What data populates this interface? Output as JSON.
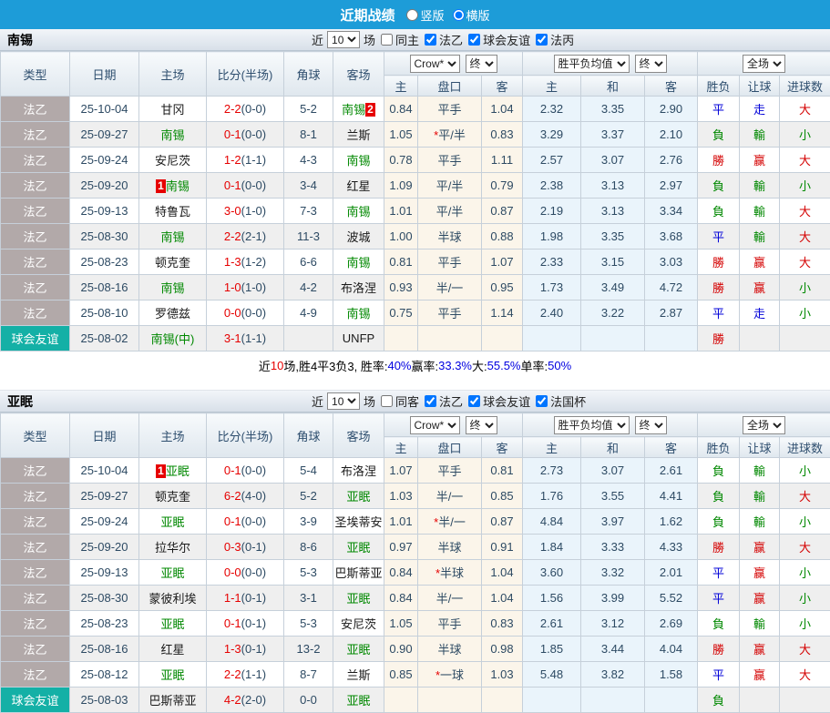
{
  "topbar": {
    "title": "近期战绩",
    "vertical_label": "竖版",
    "horizontal_label": "横版",
    "vertical_checked": false,
    "horizontal_checked": true
  },
  "labels": {
    "near": "近",
    "games": "场"
  },
  "colors": {
    "topbar_blue": "#1d9cd8",
    "league_type_bg": "#b2a9a9",
    "friendly_type_bg": "#14b0a6",
    "win_red": "#d40000",
    "lose_green": "#008800",
    "draw_blue": "#0000d8",
    "odds_col_bg": "#fbf5ea",
    "mean_col_bg": "#eaf4fb",
    "badge_red": "#e60000"
  },
  "table": {
    "main_columns": [
      "类型",
      "日期",
      "主场",
      "比分(半场)",
      "角球",
      "客场"
    ],
    "sub_columns": [
      "主",
      "盘口",
      "客",
      "主",
      "和",
      "客",
      "胜负",
      "让球",
      "进球数"
    ]
  },
  "sections": [
    {
      "team": "南锡",
      "filter": {
        "count": "10",
        "same_label": "同主",
        "same_checked": false,
        "leagues": [
          {
            "label": "法乙",
            "checked": true
          },
          {
            "label": "球会友谊",
            "checked": true
          },
          {
            "label": "法丙",
            "checked": true
          }
        ]
      },
      "dropdowns": {
        "company": "Crow*",
        "time1": "终",
        "mean": "胜平负均值",
        "time2": "终",
        "scope": "全场"
      },
      "rows": [
        {
          "type": "法乙",
          "type_kind": "league",
          "date": "25-10-04",
          "home": {
            "name": "甘冈",
            "green": false
          },
          "score": "2-2",
          "half": "(0-0)",
          "corner": "5-2",
          "away": {
            "name": "南锡",
            "green": true,
            "badge_after": "2"
          },
          "odds": [
            "0.84",
            "平手",
            "1.04"
          ],
          "star": false,
          "mean": [
            "2.32",
            "3.35",
            "2.90"
          ],
          "results": [
            {
              "t": "平",
              "c": "blue"
            },
            {
              "t": "走",
              "c": "blue"
            },
            {
              "t": "大",
              "c": "red"
            }
          ]
        },
        {
          "type": "法乙",
          "type_kind": "league",
          "date": "25-09-27",
          "home": {
            "name": "南锡",
            "green": true
          },
          "score": "0-1",
          "half": "(0-0)",
          "corner": "8-1",
          "away": {
            "name": "兰斯",
            "green": false
          },
          "odds": [
            "1.05",
            "平/半",
            "0.83"
          ],
          "star": true,
          "mean": [
            "3.29",
            "3.37",
            "2.10"
          ],
          "results": [
            {
              "t": "負",
              "c": "green"
            },
            {
              "t": "輸",
              "c": "green"
            },
            {
              "t": "小",
              "c": "green"
            }
          ]
        },
        {
          "type": "法乙",
          "type_kind": "league",
          "date": "25-09-24",
          "home": {
            "name": "安尼茨",
            "green": false
          },
          "score": "1-2",
          "half": "(1-1)",
          "corner": "4-3",
          "away": {
            "name": "南锡",
            "green": true
          },
          "odds": [
            "0.78",
            "平手",
            "1.11"
          ],
          "star": false,
          "mean": [
            "2.57",
            "3.07",
            "2.76"
          ],
          "results": [
            {
              "t": "勝",
              "c": "red"
            },
            {
              "t": "赢",
              "c": "red"
            },
            {
              "t": "大",
              "c": "red"
            }
          ]
        },
        {
          "type": "法乙",
          "type_kind": "league",
          "date": "25-09-20",
          "home": {
            "name": "南锡",
            "green": true,
            "badge_before": "1"
          },
          "score": "0-1",
          "half": "(0-0)",
          "corner": "3-4",
          "away": {
            "name": "红星",
            "green": false
          },
          "odds": [
            "1.09",
            "平/半",
            "0.79"
          ],
          "star": false,
          "mean": [
            "2.38",
            "3.13",
            "2.97"
          ],
          "results": [
            {
              "t": "負",
              "c": "green"
            },
            {
              "t": "輸",
              "c": "green"
            },
            {
              "t": "小",
              "c": "green"
            }
          ]
        },
        {
          "type": "法乙",
          "type_kind": "league",
          "date": "25-09-13",
          "home": {
            "name": "特鲁瓦",
            "green": false
          },
          "score": "3-0",
          "half": "(1-0)",
          "corner": "7-3",
          "away": {
            "name": "南锡",
            "green": true
          },
          "odds": [
            "1.01",
            "平/半",
            "0.87"
          ],
          "star": false,
          "mean": [
            "2.19",
            "3.13",
            "3.34"
          ],
          "results": [
            {
              "t": "負",
              "c": "green"
            },
            {
              "t": "輸",
              "c": "green"
            },
            {
              "t": "大",
              "c": "red"
            }
          ]
        },
        {
          "type": "法乙",
          "type_kind": "league",
          "date": "25-08-30",
          "home": {
            "name": "南锡",
            "green": true
          },
          "score": "2-2",
          "half": "(2-1)",
          "corner": "11-3",
          "away": {
            "name": "波城",
            "green": false
          },
          "odds": [
            "1.00",
            "半球",
            "0.88"
          ],
          "star": false,
          "mean": [
            "1.98",
            "3.35",
            "3.68"
          ],
          "results": [
            {
              "t": "平",
              "c": "blue"
            },
            {
              "t": "輸",
              "c": "green"
            },
            {
              "t": "大",
              "c": "red"
            }
          ]
        },
        {
          "type": "法乙",
          "type_kind": "league",
          "date": "25-08-23",
          "home": {
            "name": "顿克奎",
            "green": false
          },
          "score": "1-3",
          "half": "(1-2)",
          "corner": "6-6",
          "away": {
            "name": "南锡",
            "green": true
          },
          "odds": [
            "0.81",
            "平手",
            "1.07"
          ],
          "star": false,
          "mean": [
            "2.33",
            "3.15",
            "3.03"
          ],
          "results": [
            {
              "t": "勝",
              "c": "red"
            },
            {
              "t": "赢",
              "c": "red"
            },
            {
              "t": "大",
              "c": "red"
            }
          ]
        },
        {
          "type": "法乙",
          "type_kind": "league",
          "date": "25-08-16",
          "home": {
            "name": "南锡",
            "green": true
          },
          "score": "1-0",
          "half": "(1-0)",
          "corner": "4-2",
          "away": {
            "name": "布洛涅",
            "green": false
          },
          "odds": [
            "0.93",
            "半/一",
            "0.95"
          ],
          "star": false,
          "mean": [
            "1.73",
            "3.49",
            "4.72"
          ],
          "results": [
            {
              "t": "勝",
              "c": "red"
            },
            {
              "t": "赢",
              "c": "red"
            },
            {
              "t": "小",
              "c": "green"
            }
          ]
        },
        {
          "type": "法乙",
          "type_kind": "league",
          "date": "25-08-10",
          "home": {
            "name": "罗德兹",
            "green": false
          },
          "score": "0-0",
          "half": "(0-0)",
          "corner": "4-9",
          "away": {
            "name": "南锡",
            "green": true
          },
          "odds": [
            "0.75",
            "平手",
            "1.14"
          ],
          "star": false,
          "mean": [
            "2.40",
            "3.22",
            "2.87"
          ],
          "results": [
            {
              "t": "平",
              "c": "blue"
            },
            {
              "t": "走",
              "c": "blue"
            },
            {
              "t": "小",
              "c": "green"
            }
          ]
        },
        {
          "type": "球会友谊",
          "type_kind": "friendly",
          "date": "25-08-02",
          "home": {
            "name": "南锡(中)",
            "green": true
          },
          "score": "3-1",
          "half": "(1-1)",
          "corner": "",
          "away": {
            "name": "UNFP",
            "green": false
          },
          "odds": [
            "",
            "",
            ""
          ],
          "star": false,
          "mean": [
            "",
            "",
            ""
          ],
          "results": [
            {
              "t": "勝",
              "c": "red"
            },
            {
              "t": "",
              "c": ""
            },
            {
              "t": "",
              "c": ""
            }
          ]
        }
      ],
      "summary": [
        {
          "t": "近",
          "c": "dark"
        },
        {
          "t": "10",
          "c": "red"
        },
        {
          "t": "场,胜4平3负3, 胜率:",
          "c": "dark"
        },
        {
          "t": "40%",
          "c": "blue"
        },
        {
          "t": " 赢率:",
          "c": "dark"
        },
        {
          "t": "33.3%",
          "c": "blue"
        },
        {
          "t": " 大:",
          "c": "dark"
        },
        {
          "t": "55.5%",
          "c": "blue"
        },
        {
          "t": " 单率:",
          "c": "dark"
        },
        {
          "t": "50%",
          "c": "blue"
        }
      ]
    },
    {
      "team": "亚眠",
      "filter": {
        "count": "10",
        "same_label": "同客",
        "same_checked": false,
        "leagues": [
          {
            "label": "法乙",
            "checked": true
          },
          {
            "label": "球会友谊",
            "checked": true
          },
          {
            "label": "法国杯",
            "checked": true
          }
        ]
      },
      "dropdowns": {
        "company": "Crow*",
        "time1": "终",
        "mean": "胜平负均值",
        "time2": "终",
        "scope": "全场"
      },
      "rows": [
        {
          "type": "法乙",
          "type_kind": "league",
          "date": "25-10-04",
          "home": {
            "name": "亚眠",
            "green": true,
            "badge_before": "1"
          },
          "score": "0-1",
          "half": "(0-0)",
          "corner": "5-4",
          "away": {
            "name": "布洛涅",
            "green": false
          },
          "odds": [
            "1.07",
            "平手",
            "0.81"
          ],
          "star": false,
          "mean": [
            "2.73",
            "3.07",
            "2.61"
          ],
          "results": [
            {
              "t": "負",
              "c": "green"
            },
            {
              "t": "輸",
              "c": "green"
            },
            {
              "t": "小",
              "c": "green"
            }
          ]
        },
        {
          "type": "法乙",
          "type_kind": "league",
          "date": "25-09-27",
          "home": {
            "name": "顿克奎",
            "green": false
          },
          "score": "6-2",
          "half": "(4-0)",
          "corner": "5-2",
          "away": {
            "name": "亚眠",
            "green": true
          },
          "odds": [
            "1.03",
            "半/一",
            "0.85"
          ],
          "star": false,
          "mean": [
            "1.76",
            "3.55",
            "4.41"
          ],
          "results": [
            {
              "t": "負",
              "c": "green"
            },
            {
              "t": "輸",
              "c": "green"
            },
            {
              "t": "大",
              "c": "red"
            }
          ]
        },
        {
          "type": "法乙",
          "type_kind": "league",
          "date": "25-09-24",
          "home": {
            "name": "亚眠",
            "green": true
          },
          "score": "0-1",
          "half": "(0-0)",
          "corner": "3-9",
          "away": {
            "name": "圣埃蒂安",
            "green": false
          },
          "odds": [
            "1.01",
            "半/一",
            "0.87"
          ],
          "star": true,
          "mean": [
            "4.84",
            "3.97",
            "1.62"
          ],
          "results": [
            {
              "t": "負",
              "c": "green"
            },
            {
              "t": "輸",
              "c": "green"
            },
            {
              "t": "小",
              "c": "green"
            }
          ]
        },
        {
          "type": "法乙",
          "type_kind": "league",
          "date": "25-09-20",
          "home": {
            "name": "拉华尔",
            "green": false
          },
          "score": "0-3",
          "half": "(0-1)",
          "corner": "8-6",
          "away": {
            "name": "亚眠",
            "green": true
          },
          "odds": [
            "0.97",
            "半球",
            "0.91"
          ],
          "star": false,
          "mean": [
            "1.84",
            "3.33",
            "4.33"
          ],
          "results": [
            {
              "t": "勝",
              "c": "red"
            },
            {
              "t": "赢",
              "c": "red"
            },
            {
              "t": "大",
              "c": "red"
            }
          ]
        },
        {
          "type": "法乙",
          "type_kind": "league",
          "date": "25-09-13",
          "home": {
            "name": "亚眠",
            "green": true
          },
          "score": "0-0",
          "half": "(0-0)",
          "corner": "5-3",
          "away": {
            "name": "巴斯蒂亚",
            "green": false
          },
          "odds": [
            "0.84",
            "半球",
            "1.04"
          ],
          "star": true,
          "mean": [
            "3.60",
            "3.32",
            "2.01"
          ],
          "results": [
            {
              "t": "平",
              "c": "blue"
            },
            {
              "t": "赢",
              "c": "red"
            },
            {
              "t": "小",
              "c": "green"
            }
          ]
        },
        {
          "type": "法乙",
          "type_kind": "league",
          "date": "25-08-30",
          "home": {
            "name": "蒙彼利埃",
            "green": false
          },
          "score": "1-1",
          "half": "(0-1)",
          "corner": "3-1",
          "away": {
            "name": "亚眠",
            "green": true
          },
          "odds": [
            "0.84",
            "半/一",
            "1.04"
          ],
          "star": false,
          "mean": [
            "1.56",
            "3.99",
            "5.52"
          ],
          "results": [
            {
              "t": "平",
              "c": "blue"
            },
            {
              "t": "赢",
              "c": "red"
            },
            {
              "t": "小",
              "c": "green"
            }
          ]
        },
        {
          "type": "法乙",
          "type_kind": "league",
          "date": "25-08-23",
          "home": {
            "name": "亚眠",
            "green": true
          },
          "score": "0-1",
          "half": "(0-1)",
          "corner": "5-3",
          "away": {
            "name": "安尼茨",
            "green": false
          },
          "odds": [
            "1.05",
            "平手",
            "0.83"
          ],
          "star": false,
          "mean": [
            "2.61",
            "3.12",
            "2.69"
          ],
          "results": [
            {
              "t": "負",
              "c": "green"
            },
            {
              "t": "輸",
              "c": "green"
            },
            {
              "t": "小",
              "c": "green"
            }
          ]
        },
        {
          "type": "法乙",
          "type_kind": "league",
          "date": "25-08-16",
          "home": {
            "name": "红星",
            "green": false
          },
          "score": "1-3",
          "half": "(0-1)",
          "corner": "13-2",
          "away": {
            "name": "亚眠",
            "green": true
          },
          "odds": [
            "0.90",
            "半球",
            "0.98"
          ],
          "star": false,
          "mean": [
            "1.85",
            "3.44",
            "4.04"
          ],
          "results": [
            {
              "t": "勝",
              "c": "red"
            },
            {
              "t": "赢",
              "c": "red"
            },
            {
              "t": "大",
              "c": "red"
            }
          ]
        },
        {
          "type": "法乙",
          "type_kind": "league",
          "date": "25-08-12",
          "home": {
            "name": "亚眠",
            "green": true
          },
          "score": "2-2",
          "half": "(1-1)",
          "corner": "8-7",
          "away": {
            "name": "兰斯",
            "green": false
          },
          "odds": [
            "0.85",
            "一球",
            "1.03"
          ],
          "star": true,
          "mean": [
            "5.48",
            "3.82",
            "1.58"
          ],
          "results": [
            {
              "t": "平",
              "c": "blue"
            },
            {
              "t": "赢",
              "c": "red"
            },
            {
              "t": "大",
              "c": "red"
            }
          ]
        },
        {
          "type": "球会友谊",
          "type_kind": "friendly",
          "date": "25-08-03",
          "home": {
            "name": "巴斯蒂亚",
            "green": false
          },
          "score": "4-2",
          "half": "(2-0)",
          "corner": "0-0",
          "away": {
            "name": "亚眠",
            "green": true
          },
          "odds": [
            "",
            "",
            ""
          ],
          "star": false,
          "mean": [
            "",
            "",
            ""
          ],
          "results": [
            {
              "t": "負",
              "c": "green"
            },
            {
              "t": "",
              "c": ""
            },
            {
              "t": "",
              "c": ""
            }
          ]
        }
      ]
    }
  ]
}
